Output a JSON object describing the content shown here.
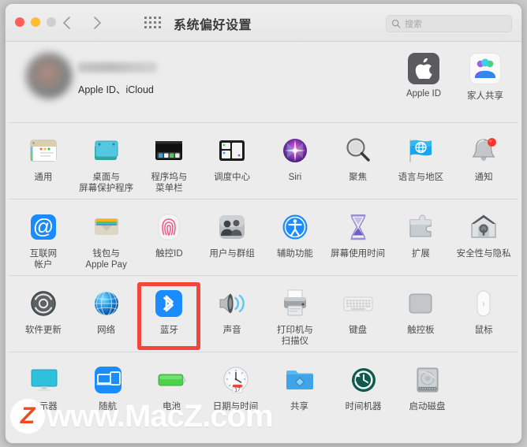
{
  "window": {
    "title": "系统偏好设置",
    "traffic_lights": [
      "close",
      "minimize",
      "zoom"
    ],
    "nav_back_icon": "chevron-left-icon",
    "nav_forward_icon": "chevron-right-icon",
    "grid_icon": "grid-view-icon"
  },
  "search": {
    "placeholder": "搜索",
    "icon": "search-icon",
    "value": ""
  },
  "account": {
    "name": "",
    "subtitle": "Apple ID、iCloud",
    "avatar_icon": "user-avatar",
    "tiles": [
      {
        "label": "Apple ID",
        "icon": "apple-logo-icon"
      },
      {
        "label": "家人共享",
        "icon": "family-sharing-icon"
      }
    ]
  },
  "rows": [
    {
      "items": [
        {
          "label": "通用",
          "icon": "general-icon"
        },
        {
          "label": "桌面与\n屏幕保护程序",
          "icon": "desktop-screensaver-icon"
        },
        {
          "label": "程序坞与\n菜单栏",
          "icon": "dock-menubar-icon"
        },
        {
          "label": "调度中心",
          "icon": "mission-control-icon"
        },
        {
          "label": "Siri",
          "icon": "siri-icon"
        },
        {
          "label": "聚焦",
          "icon": "spotlight-icon"
        },
        {
          "label": "语言与地区",
          "icon": "language-region-icon"
        },
        {
          "label": "通知",
          "icon": "notifications-icon",
          "badge": true
        }
      ]
    },
    {
      "items": [
        {
          "label": "互联网\n帐户",
          "icon": "internet-accounts-icon"
        },
        {
          "label": "钱包与\nApple Pay",
          "icon": "wallet-applepay-icon"
        },
        {
          "label": "触控ID",
          "icon": "touch-id-icon"
        },
        {
          "label": "用户与群组",
          "icon": "users-groups-icon"
        },
        {
          "label": "辅助功能",
          "icon": "accessibility-icon"
        },
        {
          "label": "屏幕使用时间",
          "icon": "screen-time-icon"
        },
        {
          "label": "扩展",
          "icon": "extensions-icon"
        },
        {
          "label": "安全性与隐私",
          "icon": "security-privacy-icon"
        }
      ]
    },
    {
      "items": [
        {
          "label": "软件更新",
          "icon": "software-update-icon"
        },
        {
          "label": "网络",
          "icon": "network-icon"
        },
        {
          "label": "蓝牙",
          "icon": "bluetooth-icon",
          "highlighted": true
        },
        {
          "label": "声音",
          "icon": "sound-icon"
        },
        {
          "label": "打印机与\n扫描仪",
          "icon": "printers-scanners-icon"
        },
        {
          "label": "键盘",
          "icon": "keyboard-icon"
        },
        {
          "label": "触控板",
          "icon": "trackpad-icon"
        },
        {
          "label": "鼠标",
          "icon": "mouse-icon"
        }
      ]
    },
    {
      "items": [
        {
          "label": "显示器",
          "icon": "displays-icon"
        },
        {
          "label": "随航",
          "icon": "sidecar-icon"
        },
        {
          "label": "电池",
          "icon": "battery-icon"
        },
        {
          "label": "日期与时间",
          "icon": "date-time-icon"
        },
        {
          "label": "共享",
          "icon": "sharing-icon"
        },
        {
          "label": "时间机器",
          "icon": "time-machine-icon"
        },
        {
          "label": "启动磁盘",
          "icon": "startup-disk-icon"
        }
      ]
    }
  ],
  "highlight": {
    "target": "蓝牙",
    "color": "#f4453c"
  },
  "watermark": {
    "logo_text": "Z",
    "text": "www.MacZ.com"
  },
  "colors": {
    "window_bg": "#ececec",
    "titlebar_bg": "#ebebeb",
    "accent_blue": "#1a8cff",
    "highlight_red": "#f4453c",
    "label_text": "#4c4c4c"
  }
}
